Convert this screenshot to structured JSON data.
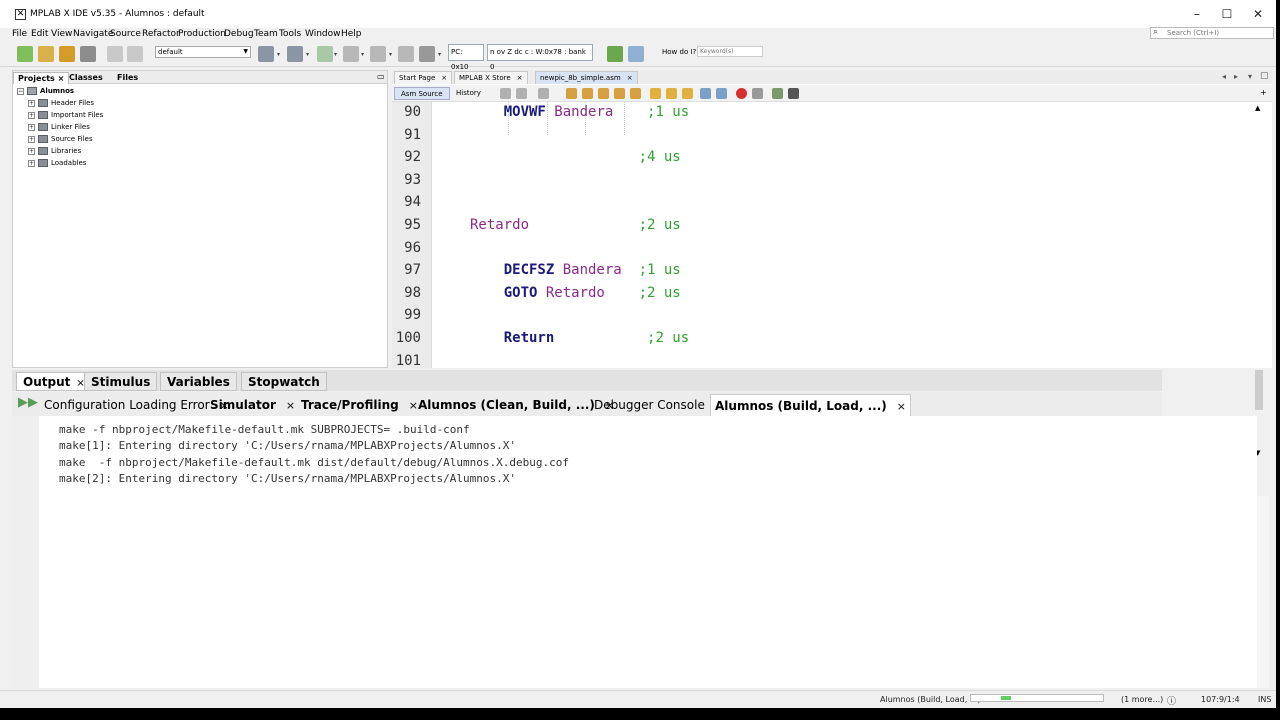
{
  "window": {
    "title": "MPLAB X IDE v5.35 - Alumnos : default"
  },
  "menu": [
    "File",
    "Edit",
    "View",
    "Navigate",
    "Source",
    "Refactor",
    "Production",
    "Debug",
    "Team",
    "Tools",
    "Window",
    "Help"
  ],
  "search": {
    "placeholder": "Search (Ctrl+I)"
  },
  "toolbar": {
    "config": "default",
    "pc": "PC: 0x10",
    "status_reg": "n ov Z dc c : W:0x78 : bank 0",
    "howdoi_label": "How do I?",
    "howdoi_placeholder": "Keyword(s)"
  },
  "project_panel": {
    "tabs": [
      "Projects",
      "Classes",
      "Files"
    ],
    "root": "Alumnos",
    "items": [
      "Header Files",
      "Important Files",
      "Linker Files",
      "Source Files",
      "Libraries",
      "Loadables"
    ]
  },
  "editor": {
    "tabs": [
      "Start Page",
      "MPLAB X Store",
      "newpic_8b_simple.asm"
    ],
    "subtabs": [
      "Asm Source",
      "History"
    ],
    "lines": [
      {
        "n": "90",
        "parts": [
          {
            "t": "    MOVWF ",
            "c": "kw"
          },
          {
            "t": "Bandera    ",
            "c": "id"
          },
          {
            "t": ";1 us",
            "c": "cm"
          }
        ]
      },
      {
        "n": "91",
        "parts": []
      },
      {
        "n": "92",
        "parts": [
          {
            "t": "                    ",
            "c": ""
          },
          {
            "t": ";4 us",
            "c": "cm"
          }
        ]
      },
      {
        "n": "93",
        "parts": []
      },
      {
        "n": "94",
        "parts": []
      },
      {
        "n": "95",
        "parts": [
          {
            "t": "Retardo             ",
            "c": "id"
          },
          {
            "t": ";2 us",
            "c": "cm"
          }
        ]
      },
      {
        "n": "96",
        "parts": []
      },
      {
        "n": "97",
        "parts": [
          {
            "t": "    DECFSZ ",
            "c": "kw"
          },
          {
            "t": "Bandera  ",
            "c": "id"
          },
          {
            "t": ";1 us",
            "c": "cm"
          }
        ]
      },
      {
        "n": "98",
        "parts": [
          {
            "t": "    GOTO ",
            "c": "kw"
          },
          {
            "t": "Retardo    ",
            "c": "id"
          },
          {
            "t": ";2 us",
            "c": "cm"
          }
        ]
      },
      {
        "n": "99",
        "parts": []
      },
      {
        "n": "100",
        "parts": [
          {
            "t": "    Return           ",
            "c": "kw"
          },
          {
            "t": ";2 us",
            "c": "cm"
          }
        ]
      },
      {
        "n": "101",
        "parts": []
      }
    ]
  },
  "output": {
    "tabs": [
      "Output",
      "Stimulus",
      "Variables",
      "Stopwatch"
    ],
    "subtabs": [
      "Configuration Loading Error",
      "Simulator",
      "Trace/Profiling",
      "Alumnos (Clean, Build, ...)",
      "Debugger Console",
      "Alumnos (Build, Load, ...)"
    ],
    "lines": [
      "make -f nbproject/Makefile-default.mk SUBPROJECTS= .build-conf",
      "make[1]: Entering directory 'C:/Users/rnama/MPLABXProjects/Alumnos.X'",
      "make  -f nbproject/Makefile-default.mk dist/default/debug/Alumnos.X.debug.cof",
      "make[2]: Entering directory 'C:/Users/rnama/MPLABXProjects/Alumnos.X'"
    ]
  },
  "status": {
    "task": "Alumnos (Build, Load, ...)",
    "more": "(1 more...)",
    "position": "107:9/1:4",
    "mode": "INS"
  }
}
